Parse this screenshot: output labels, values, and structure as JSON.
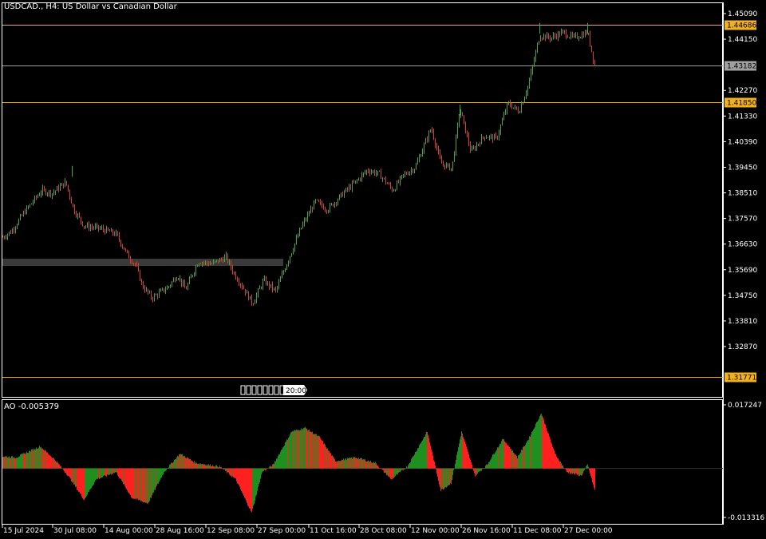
{
  "window": {
    "symbol_title": "USDCAD., H4:  US Dollar vs Canadian Dollar"
  },
  "price_axis": {
    "ticks": [
      "1.45090",
      "1.44150",
      "1.42270",
      "1.41330",
      "1.40390",
      "1.39450",
      "1.38510",
      "1.37570",
      "1.36630",
      "1.35690",
      "1.34750",
      "1.33810",
      "1.32870"
    ]
  },
  "levels": [
    {
      "label": "1.44686",
      "value": 1.44686,
      "color": "#f0b020",
      "text_color": "#000000"
    },
    {
      "label": "1.43182",
      "value": 1.43182,
      "color": "#a0a0a0",
      "text_color": "#000000"
    },
    {
      "label": "1.41850",
      "value": 1.4185,
      "color": "#f0b020",
      "text_color": "#000000"
    },
    {
      "label": "1.31771",
      "value": 1.31771,
      "color": "#f0b020",
      "text_color": "#000000"
    }
  ],
  "time_marker_label": "20:00",
  "indicator": {
    "label": "AO -0.005379",
    "axis_top": "0.017247",
    "axis_bottom": "-0.013316",
    "up_color": "#1f8f1f",
    "down_color": "#ff2020"
  },
  "time_axis": {
    "labels": [
      "15 Jul 2024",
      "30 Jul 08:00",
      "14 Aug 00:00",
      "28 Aug 16:00",
      "12 Sep 08:00",
      "27 Sep 00:00",
      "11 Oct 16:00",
      "28 Oct 08:00",
      "12 Nov 00:00",
      "26 Nov 16:00",
      "11 Dec 08:00",
      "27 Dec 00:00"
    ]
  },
  "colors": {
    "background": "#000000",
    "bull_candle": "#3caa3c",
    "bear_candle": "#e03c28",
    "text": "#ffffff",
    "grid_frame": "#ffffff"
  },
  "chart_data": {
    "type": "candlestick",
    "title": "USDCAD., H4:  US Dollar vs Canadian Dollar",
    "ylim": [
      1.3187,
      1.4533
    ],
    "price_path": [
      [
        0,
        1.3683
      ],
      [
        14,
        1.371
      ],
      [
        30,
        1.378
      ],
      [
        52,
        1.386
      ],
      [
        65,
        1.385
      ],
      [
        82,
        1.389
      ],
      [
        92,
        1.379
      ],
      [
        105,
        1.373
      ],
      [
        125,
        1.372
      ],
      [
        145,
        1.37
      ],
      [
        160,
        1.362
      ],
      [
        170,
        1.3585
      ],
      [
        178,
        1.351
      ],
      [
        190,
        1.3465
      ],
      [
        210,
        1.3505
      ],
      [
        222,
        1.355
      ],
      [
        232,
        1.3495
      ],
      [
        248,
        1.36
      ],
      [
        265,
        1.359
      ],
      [
        283,
        1.3615
      ],
      [
        292,
        1.356
      ],
      [
        305,
        1.35
      ],
      [
        316,
        1.3445
      ],
      [
        330,
        1.353
      ],
      [
        345,
        1.349
      ],
      [
        360,
        1.36
      ],
      [
        378,
        1.373
      ],
      [
        395,
        1.382
      ],
      [
        410,
        1.379
      ],
      [
        430,
        1.385
      ],
      [
        445,
        1.389
      ],
      [
        460,
        1.3935
      ],
      [
        475,
        1.392
      ],
      [
        492,
        1.386
      ],
      [
        505,
        1.3915
      ],
      [
        520,
        1.3945
      ],
      [
        540,
        1.409
      ],
      [
        552,
        1.396
      ],
      [
        566,
        1.394
      ],
      [
        576,
        1.416
      ],
      [
        590,
        1.4
      ],
      [
        606,
        1.406
      ],
      [
        622,
        1.405
      ],
      [
        636,
        1.418
      ],
      [
        650,
        1.415
      ],
      [
        662,
        1.425
      ],
      [
        676,
        1.443
      ],
      [
        690,
        1.442
      ],
      [
        705,
        1.444
      ],
      [
        718,
        1.442
      ],
      [
        728,
        1.443
      ],
      [
        736,
        1.444
      ],
      [
        745,
        1.4318
      ]
    ],
    "ao_path": [
      [
        0,
        0.0033
      ],
      [
        20,
        0.003
      ],
      [
        50,
        0.006
      ],
      [
        70,
        0.002
      ],
      [
        85,
        -0.002
      ],
      [
        105,
        -0.0085
      ],
      [
        120,
        -0.003
      ],
      [
        145,
        -0.001
      ],
      [
        165,
        -0.008
      ],
      [
        185,
        -0.0095
      ],
      [
        205,
        -0.001
      ],
      [
        225,
        0.004
      ],
      [
        245,
        0.0015
      ],
      [
        275,
        0.0005
      ],
      [
        295,
        -0.003
      ],
      [
        315,
        -0.012
      ],
      [
        328,
        -0.001
      ],
      [
        342,
        0.001
      ],
      [
        365,
        0.01
      ],
      [
        382,
        0.011
      ],
      [
        400,
        0.0085
      ],
      [
        420,
        0.002
      ],
      [
        445,
        0.003
      ],
      [
        470,
        0.0015
      ],
      [
        490,
        -0.003
      ],
      [
        510,
        0.0005
      ],
      [
        535,
        0.01
      ],
      [
        552,
        -0.006
      ],
      [
        565,
        -0.004
      ],
      [
        578,
        0.01
      ],
      [
        595,
        -0.002
      ],
      [
        610,
        0.001
      ],
      [
        630,
        0.008
      ],
      [
        648,
        0.003
      ],
      [
        662,
        0.008
      ],
      [
        678,
        0.015
      ],
      [
        695,
        0.004
      ],
      [
        710,
        -0.001
      ],
      [
        728,
        -0.002
      ],
      [
        736,
        0.001
      ],
      [
        745,
        -0.006
      ]
    ]
  }
}
